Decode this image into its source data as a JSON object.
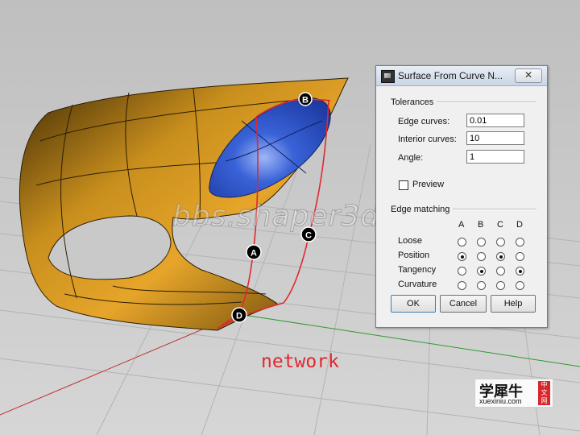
{
  "dialog": {
    "title": "Surface From Curve N...",
    "close_label": "✕",
    "tolerances": {
      "heading": "Tolerances",
      "edge_curves_label": "Edge curves:",
      "edge_curves_value": "0.01",
      "interior_curves_label": "Interior curves:",
      "interior_curves_value": "10",
      "angle_label": "Angle:",
      "angle_value": "1"
    },
    "preview_label": "Preview",
    "preview_checked": false,
    "edge_matching": {
      "heading": "Edge matching",
      "columns": [
        "A",
        "B",
        "C",
        "D"
      ],
      "rows": [
        {
          "label": "Loose",
          "selected": [
            false,
            false,
            false,
            false
          ]
        },
        {
          "label": "Position",
          "selected": [
            true,
            false,
            true,
            false
          ]
        },
        {
          "label": "Tangency",
          "selected": [
            false,
            true,
            false,
            true
          ]
        },
        {
          "label": "Curvature",
          "selected": [
            false,
            false,
            false,
            false
          ]
        }
      ]
    },
    "buttons": {
      "ok": "OK",
      "cancel": "Cancel",
      "help": "Help"
    }
  },
  "viewport": {
    "curve_markers": [
      "A",
      "B",
      "C",
      "D"
    ],
    "watermark": "bbs.shaper3d.cn",
    "caption": "network",
    "surface_color": "#c08a1c",
    "patch_color": "#2f55c8",
    "curve_color": "#e0292f"
  },
  "logo": {
    "brand": "学犀牛",
    "url": "xuexiniu.com",
    "badge": "中文网"
  }
}
